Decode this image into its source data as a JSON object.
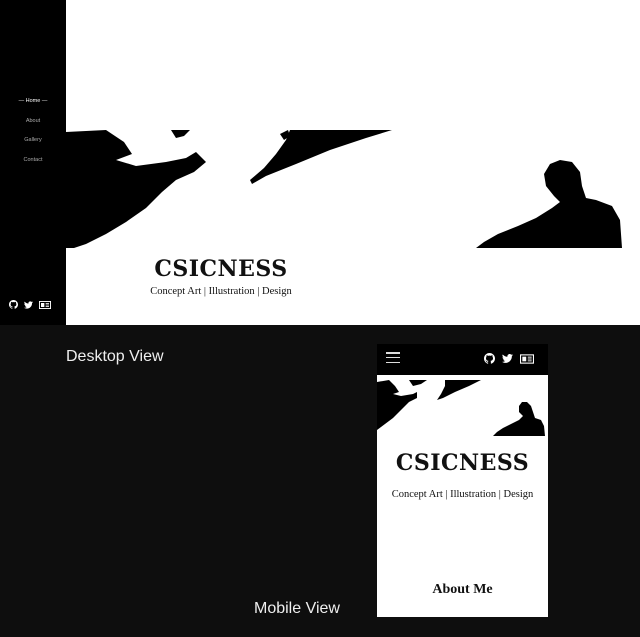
{
  "site": {
    "title": "CSICNESS",
    "tagline": "Concept Art | Illustration | Design",
    "nav": [
      {
        "label": "— Home —",
        "active": true
      },
      {
        "label": "About",
        "active": false
      },
      {
        "label": "Gallery",
        "active": false
      },
      {
        "label": "Contact",
        "active": false
      }
    ],
    "social_icons": [
      "github-icon",
      "twitter-icon",
      "id-card-icon"
    ]
  },
  "captions": {
    "desktop": "Desktop View",
    "mobile": "Mobile View"
  },
  "mobile": {
    "section_heading": "About Me",
    "menu_icon": "hamburger-icon"
  },
  "colors": {
    "background": "#0e0e0e",
    "sidebar": "#000000",
    "content": "#ffffff",
    "text": "#111111"
  }
}
